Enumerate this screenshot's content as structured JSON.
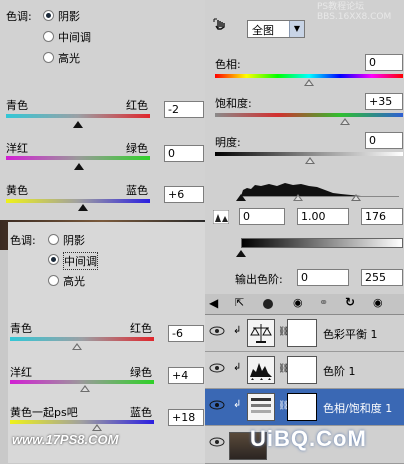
{
  "top_left_panel": {
    "tone_label": "色调:",
    "tones": [
      "阴影",
      "中间调",
      "高光"
    ],
    "selected_tone": "阴影",
    "sliders": [
      {
        "left": "青色",
        "right": "红色",
        "value": "-2"
      },
      {
        "left": "洋红",
        "right": "绿色",
        "value": "0"
      },
      {
        "left": "黄色",
        "right": "蓝色",
        "value": "+6"
      }
    ]
  },
  "bottom_left_panel": {
    "tone_label": "色调:",
    "tones": [
      "阴影",
      "中间调",
      "高光"
    ],
    "selected_tone": "中间调",
    "sliders": [
      {
        "left": "青色",
        "right": "红色",
        "value": "-6"
      },
      {
        "left": "洋红",
        "right": "绿色",
        "value": "+4"
      },
      {
        "left": "黄色",
        "right": "蓝色",
        "value": "+18"
      }
    ],
    "watermark_top": "黄色一起ps吧",
    "watermark_bottom": "www.17PS8.COM"
  },
  "hue_sat_panel": {
    "watermark": "PS教程论坛\nBBS.16XX8.COM",
    "edit_select": "全图",
    "hue_label": "色相:",
    "hue_value": "0",
    "saturation_label": "饱和度:",
    "saturation_value": "+35",
    "lightness_label": "明度:",
    "lightness_value": "0"
  },
  "levels_panel": {
    "input_values": [
      "0",
      "1.00",
      "176"
    ],
    "output_label": "输出色阶:",
    "output_values": [
      "0",
      "255"
    ]
  },
  "layers_panel": {
    "layers": [
      {
        "name": "色彩平衡 1",
        "selected": false
      },
      {
        "name": "色阶 1",
        "selected": false
      },
      {
        "name": "色相/饱和度 1",
        "selected": true
      },
      {
        "name": "",
        "selected": false
      }
    ],
    "watermark": "UiBQ.CoM"
  },
  "colors": {
    "panel_bg": "#d4d4d4",
    "selection_blue": "#3a68b4",
    "cyan": "#31c7d6",
    "red": "#e0262c",
    "magenta": "#d21fd3",
    "green": "#2fd128",
    "yellow": "#eff21a",
    "blue": "#2b1fe0"
  }
}
